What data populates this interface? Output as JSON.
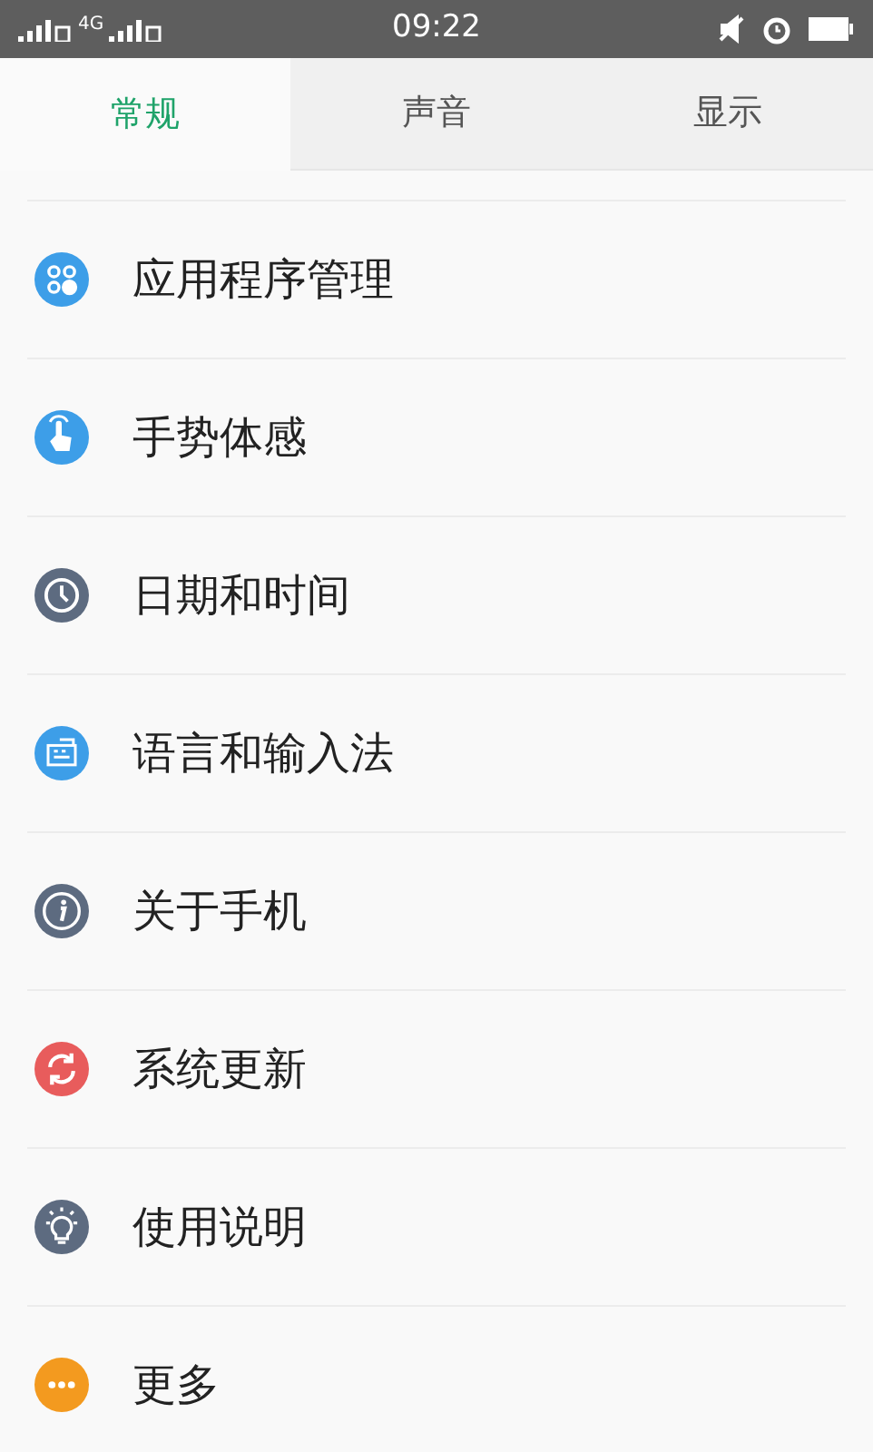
{
  "status_bar": {
    "network": "4G",
    "time": "09:22"
  },
  "tabs": [
    {
      "label": "常规",
      "selected": true
    },
    {
      "label": "声音",
      "selected": false
    },
    {
      "label": "显示",
      "selected": false
    }
  ],
  "items": [
    {
      "label": "应用程序管理",
      "kind": "apps",
      "color": "#3d9ee8"
    },
    {
      "label": "手势体感",
      "kind": "gesture",
      "color": "#3d9ee8"
    },
    {
      "label": "日期和时间",
      "kind": "clock",
      "color": "#5d6b80"
    },
    {
      "label": "语言和输入法",
      "kind": "keyboard",
      "color": "#3d9ee8"
    },
    {
      "label": "关于手机",
      "kind": "info",
      "color": "#5d6b80"
    },
    {
      "label": "系统更新",
      "kind": "refresh",
      "color": "#e85c5c"
    },
    {
      "label": "使用说明",
      "kind": "bulb",
      "color": "#5d6b80"
    },
    {
      "label": "更多",
      "kind": "more",
      "color": "#f39a1f"
    }
  ]
}
